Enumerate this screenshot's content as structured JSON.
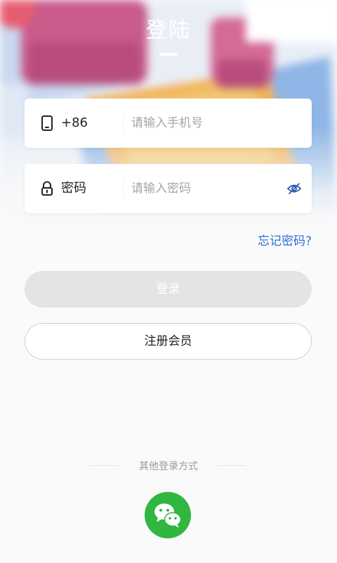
{
  "header": {
    "title": "登陆"
  },
  "phone": {
    "prefix": "+86",
    "placeholder": "请输入手机号"
  },
  "password": {
    "label": "密码",
    "placeholder": "请输入密码"
  },
  "links": {
    "forgot": "忘记密码?"
  },
  "buttons": {
    "login": "登录",
    "register": "注册会员"
  },
  "footer": {
    "other_login": "其他登录方式",
    "wechat_icon": "wechat-icon"
  },
  "colors": {
    "accent": "#2f6fd6",
    "wechat": "#31b640",
    "login_disabled": "#e4e4e4"
  }
}
